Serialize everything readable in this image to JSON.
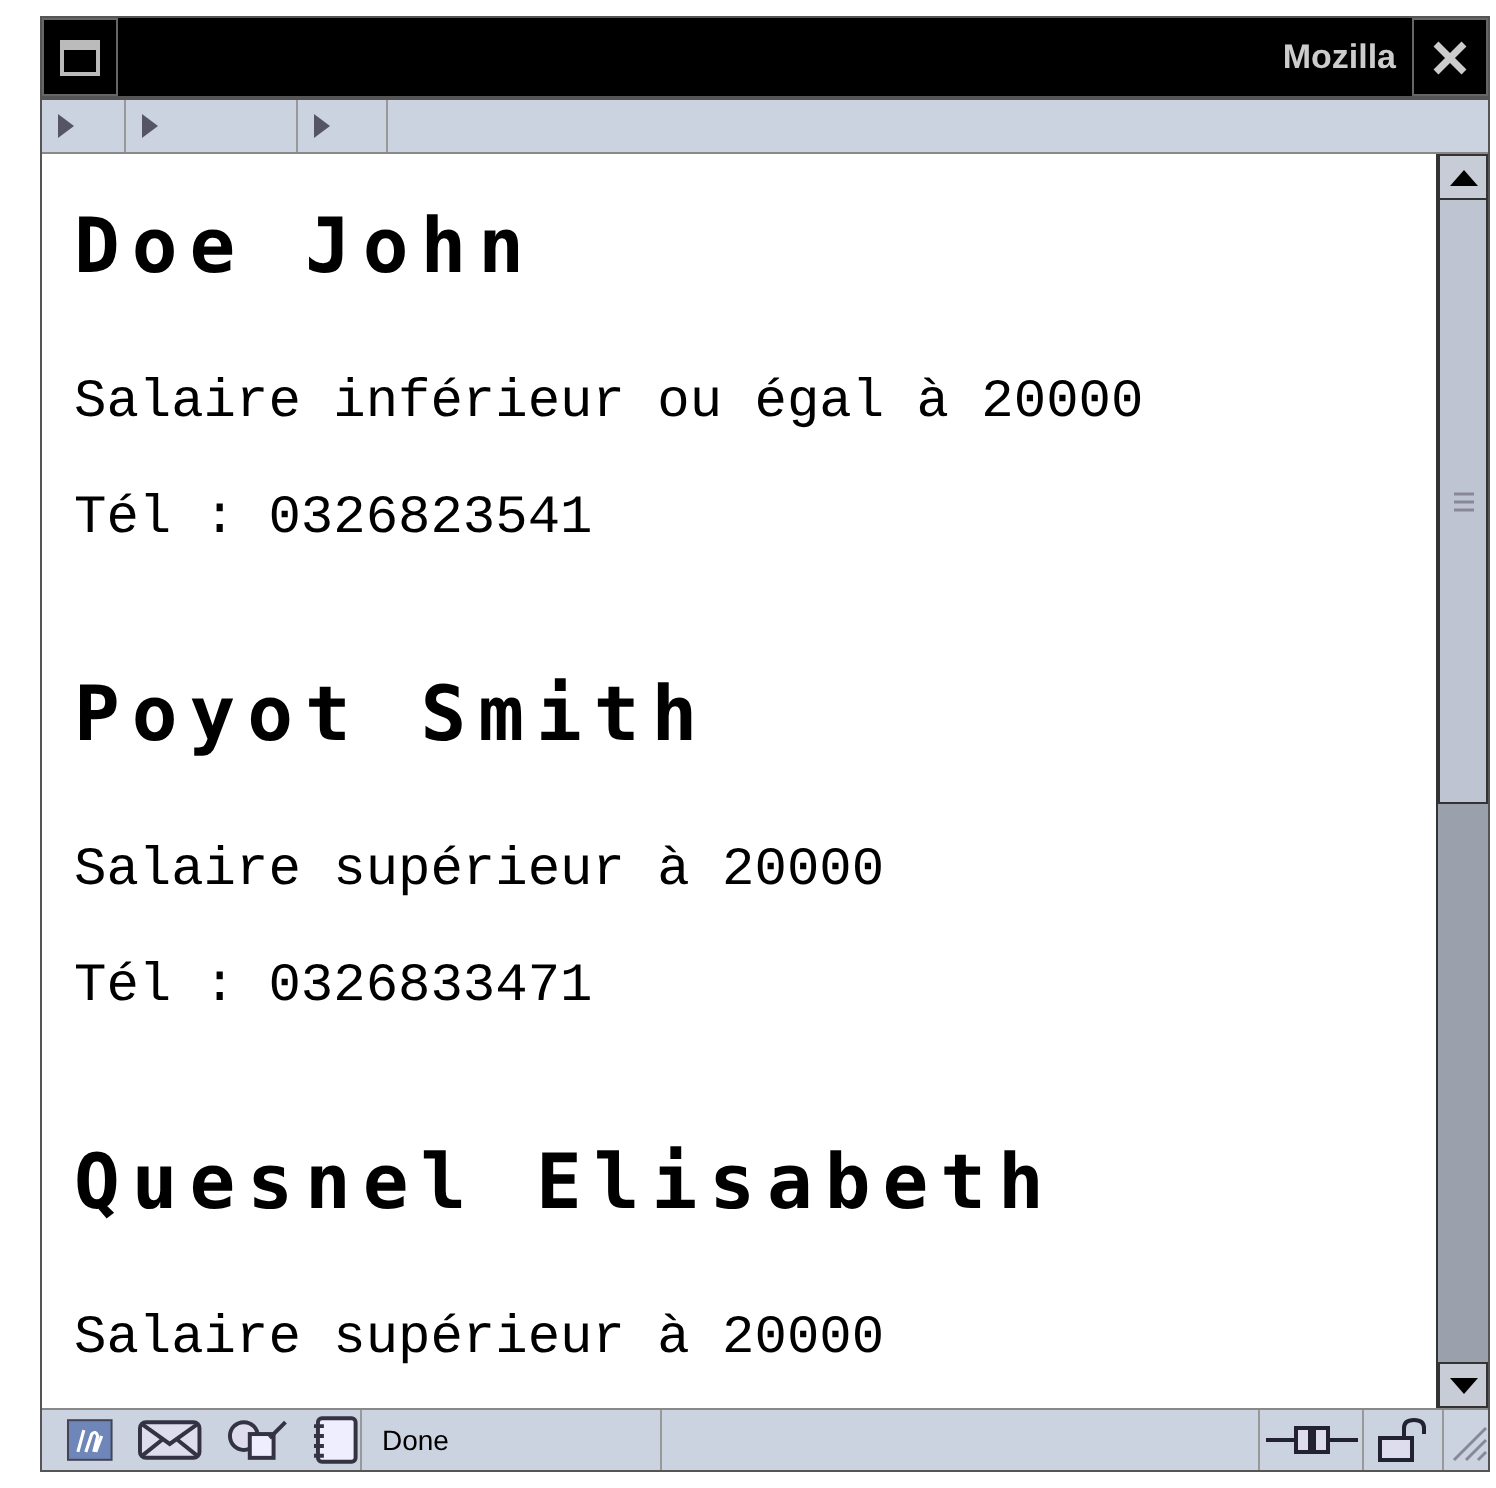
{
  "window": {
    "title": "Mozilla"
  },
  "records": [
    {
      "name": "Doe John",
      "lines": [
        "Salaire inférieur ou égal à 20000",
        "Tél : 0326823541"
      ]
    },
    {
      "name": "Poyot Smith",
      "lines": [
        "Salaire supérieur à 20000",
        "Tél : 0326833471"
      ]
    },
    {
      "name": "Quesnel Elisabeth",
      "lines": [
        "Salaire supérieur à 20000"
      ]
    }
  ],
  "status_bar": {
    "text": "Done"
  }
}
